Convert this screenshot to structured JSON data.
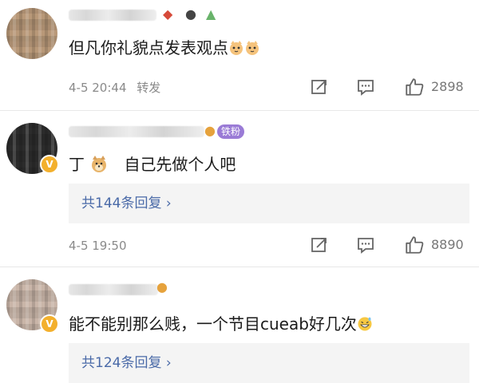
{
  "comments": [
    {
      "text": "但凡你礼貌点发表观点",
      "time": "4-5 20:44",
      "forward": "转发",
      "likes": "2898"
    },
    {
      "text_prefix": "丁",
      "text_suffix": "自己先做个人吧",
      "badge": "铁粉",
      "time": "4-5 19:50",
      "likes": "8890",
      "replies": "共144条回复"
    },
    {
      "text": "能不能别那么贱，一个节目cueab好几次",
      "replies": "共124条回复"
    }
  ],
  "icons": {
    "share": "share-icon",
    "comment": "comment-icon",
    "like": "thumbs-up-icon",
    "chevron": "chevron-right-icon"
  },
  "colors": {
    "link": "#4a6aa8",
    "meta": "#8a8a8a",
    "reply_bg": "#f4f4f4",
    "vip": "#f3b02d",
    "fan_badge": "#9a7bd6"
  }
}
